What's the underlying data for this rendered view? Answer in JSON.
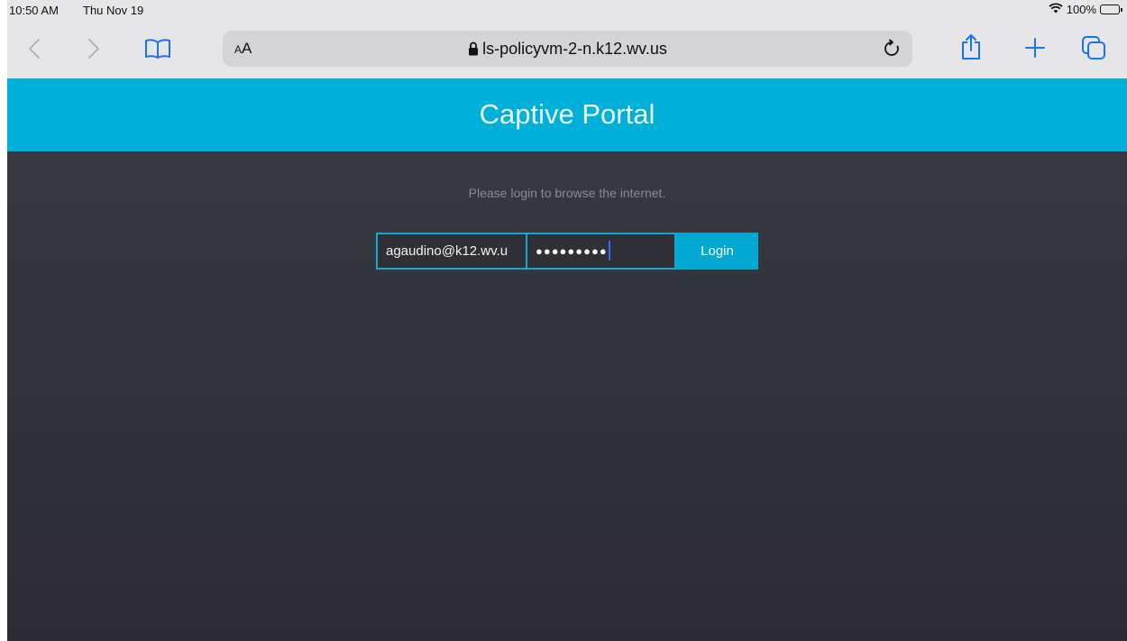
{
  "status_bar": {
    "time": "10:50 AM",
    "date": "Thu Nov 19",
    "battery": "100%"
  },
  "toolbar": {
    "text_size_small": "A",
    "text_size_large": "A",
    "url": "ls-policyvm-2-n.k12.wv.us",
    "icons": [
      "back-icon",
      "forward-icon",
      "bookmarks-icon",
      "lock-icon",
      "reload-icon",
      "share-icon",
      "plus-icon",
      "tabs-icon",
      "wifi-icon",
      "battery-icon"
    ]
  },
  "page": {
    "title": "Captive Portal",
    "prompt": "Please login to browse the internet.",
    "email_value": "agaudino@k12.wv.u",
    "password_mask": "●●●●●●●●●",
    "login_label": "Login"
  },
  "colors": {
    "header": "#00b0d8",
    "button": "#00a8d2",
    "background": "#2e2e35",
    "field_border": "#1aa7cf"
  }
}
